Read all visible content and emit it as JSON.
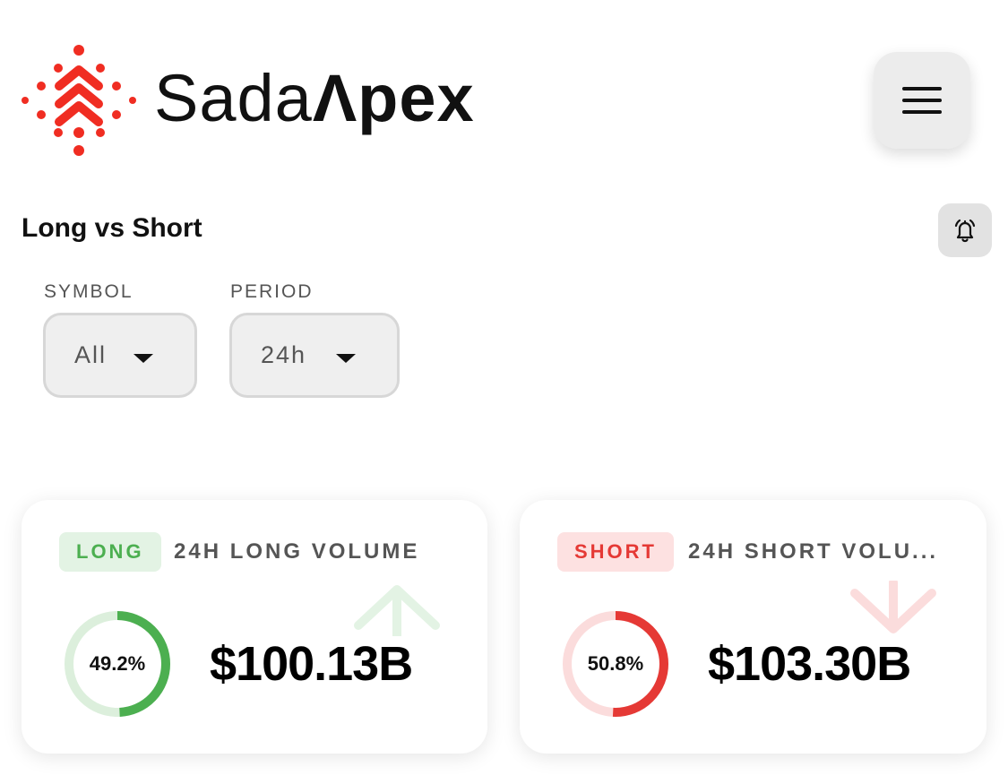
{
  "header": {
    "brand_name_regular": "Sada",
    "brand_name_bold": "Λpex",
    "menu_icon": "hamburger-menu-icon"
  },
  "section": {
    "title": "Long vs Short",
    "alert_icon": "bell-alert-icon"
  },
  "filters": {
    "symbol": {
      "label": "SYMBOL",
      "value": "All"
    },
    "period": {
      "label": "PERIOD",
      "value": "24h"
    }
  },
  "cards": {
    "long": {
      "badge": "LONG",
      "title": "24H LONG VOLUME",
      "percent_label": "49.2%",
      "percent": 49.2,
      "amount": "$100.13B",
      "color": "#4caf50",
      "track_color": "#dcefdc",
      "bg_icon": "arrow-up-icon"
    },
    "short": {
      "badge": "SHORT",
      "title": "24H SHORT VOLU...",
      "percent_label": "50.8%",
      "percent": 50.8,
      "amount": "$103.30B",
      "color": "#e53935",
      "track_color": "#fbdcdc",
      "bg_icon": "arrow-down-icon"
    }
  },
  "colors": {
    "brand_red": "#f02d22"
  }
}
